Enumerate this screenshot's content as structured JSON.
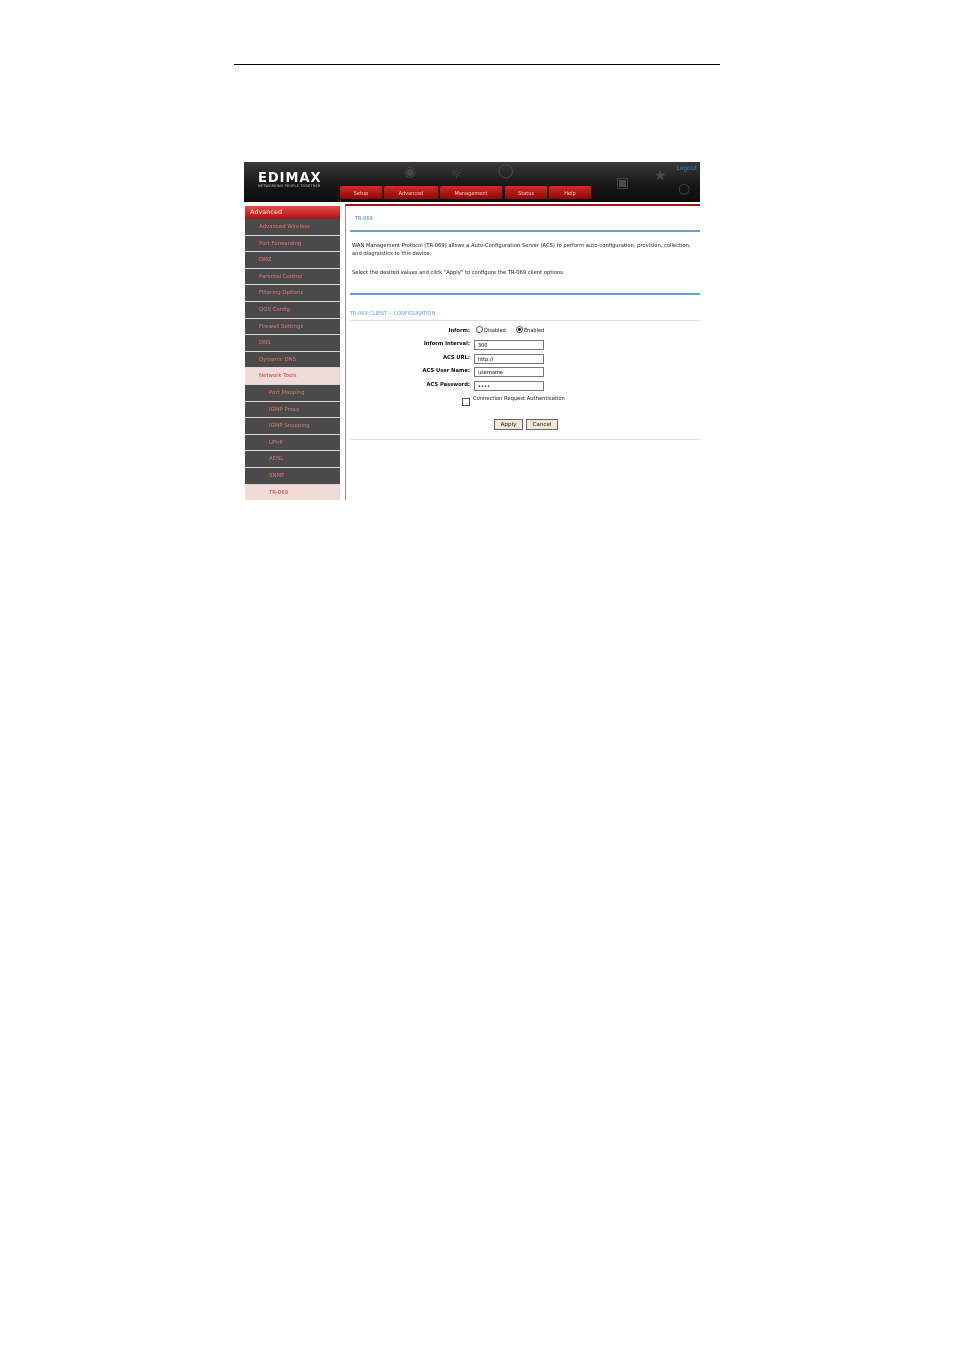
{
  "header": {
    "logo": "EDIMAX",
    "tagline": "NETWORKING PEOPLE TOGETHER",
    "user_link": "",
    "logout_label": "Logout",
    "tabs": [
      "Setup",
      "Advanced",
      "Management",
      "Status",
      "Help"
    ]
  },
  "sidebar": {
    "title": "Advanced",
    "items": [
      "Advanced Wireless",
      "Port Forwarding",
      "DMZ",
      "Parental Control",
      "Filtering Options",
      "QOS Config",
      "Firewall Settings",
      "DNS",
      "Dynamic DNS",
      "Network Tools",
      "Port Mapping",
      "IGMP Proxy",
      "IGMP Snooping",
      "UPnP",
      "ADSL",
      "SNMP",
      "TR-069"
    ]
  },
  "main": {
    "page_title": "TR-069",
    "desc1": "WAN Management Protocol (TR-069) allows a Auto-Configuration Server (ACS) to perform auto-configuration, provision, collection, and diagnostics to this device.",
    "desc2": "Select the desired values and click \"Apply\" to configure the TR-069 client options.",
    "section_title": "TR-069 CLIENT -- CONFIGURATION",
    "inform_label": "Inform:",
    "inform_disabled": "Disabled",
    "inform_enabled": "Enabled",
    "interval_label": "Inform Interval:",
    "interval_value": "300",
    "acs_url_label": "ACS URL:",
    "acs_url_value": "http://",
    "acs_user_label": "ACS User Name:",
    "acs_user_value": "username",
    "acs_pass_label": "ACS Password:",
    "acs_pass_value": "••••",
    "conn_req_label": "Connection Request Authentication",
    "apply_label": "Apply",
    "cancel_label": "Cancel"
  },
  "colors": {
    "brand_red": "#b40f0f",
    "link_blue": "#4a78c8",
    "sidebar_bg": "#4a4a4a"
  }
}
